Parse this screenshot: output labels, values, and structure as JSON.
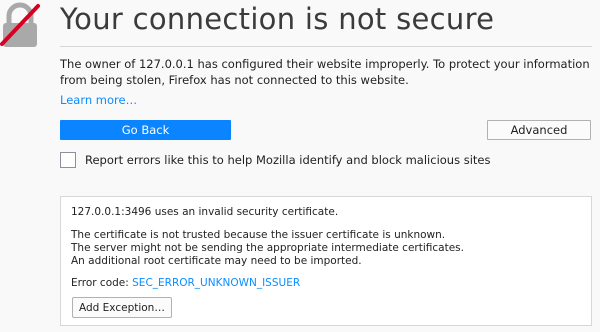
{
  "page": {
    "title": "Your connection is not secure",
    "description": "The owner of 127.0.0.1 has configured their website improperly. To protect your information from being stolen, Firefox has not connected to this website.",
    "learn_more": "Learn more…"
  },
  "buttons": {
    "go_back": "Go Back",
    "advanced": "Advanced",
    "add_exception": "Add Exception…"
  },
  "report": {
    "checked": false,
    "label": "Report errors like this to help Mozilla identify and block malicious sites"
  },
  "advanced_panel": {
    "summary": "127.0.0.1:3496 uses an invalid security certificate.",
    "details": [
      "The certificate is not trusted because the issuer certificate is unknown.",
      "The server might not be sending the appropriate intermediate certificates.",
      "An additional root certificate may need to be imported."
    ],
    "error_code_label": "Error code:",
    "error_code": "SEC_ERROR_UNKNOWN_ISSUER"
  },
  "icons": {
    "lock": "broken-lock-icon"
  },
  "colors": {
    "primary": "#0a84ff",
    "link": "#0a8dff",
    "warning_strike": "#d70022",
    "background": "#f9f9fa"
  }
}
